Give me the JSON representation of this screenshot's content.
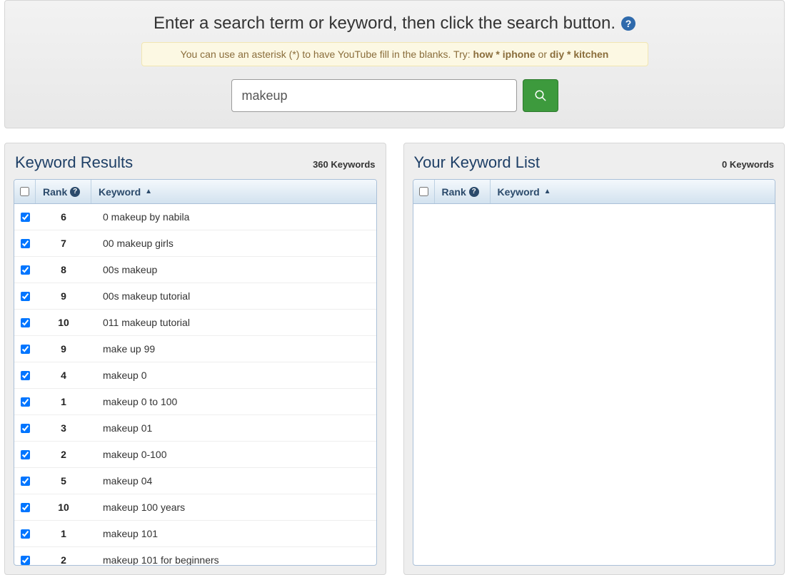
{
  "header": {
    "title": "Enter a search term or keyword, then click the search button.",
    "hint_prefix": "You can use an asterisk (*) to have YouTube fill in the blanks. Try: ",
    "hint_example1": "how * iphone",
    "hint_or": " or ",
    "hint_example2": "diy * kitchen",
    "search_value": "makeup"
  },
  "leftPanel": {
    "title": "Keyword Results",
    "count_label": "360 Keywords",
    "columns": {
      "rank": "Rank",
      "keyword": "Keyword"
    },
    "rows": [
      {
        "checked": true,
        "rank": "6",
        "keyword": "0 makeup by nabila"
      },
      {
        "checked": true,
        "rank": "7",
        "keyword": "00 makeup girls"
      },
      {
        "checked": true,
        "rank": "8",
        "keyword": "00s makeup"
      },
      {
        "checked": true,
        "rank": "9",
        "keyword": "00s makeup tutorial"
      },
      {
        "checked": true,
        "rank": "10",
        "keyword": "011 makeup tutorial"
      },
      {
        "checked": true,
        "rank": "9",
        "keyword": "make up 99"
      },
      {
        "checked": true,
        "rank": "4",
        "keyword": "makeup 0"
      },
      {
        "checked": true,
        "rank": "1",
        "keyword": "makeup 0 to 100"
      },
      {
        "checked": true,
        "rank": "3",
        "keyword": "makeup 01"
      },
      {
        "checked": true,
        "rank": "2",
        "keyword": "makeup 0-100"
      },
      {
        "checked": true,
        "rank": "5",
        "keyword": "makeup 04"
      },
      {
        "checked": true,
        "rank": "10",
        "keyword": "makeup 100 years"
      },
      {
        "checked": true,
        "rank": "1",
        "keyword": "makeup 101"
      },
      {
        "checked": true,
        "rank": "2",
        "keyword": "makeup 101 for beginners"
      }
    ]
  },
  "rightPanel": {
    "title": "Your Keyword List",
    "count_label": "0 Keywords",
    "columns": {
      "rank": "Rank",
      "keyword": "Keyword"
    },
    "rows": []
  }
}
